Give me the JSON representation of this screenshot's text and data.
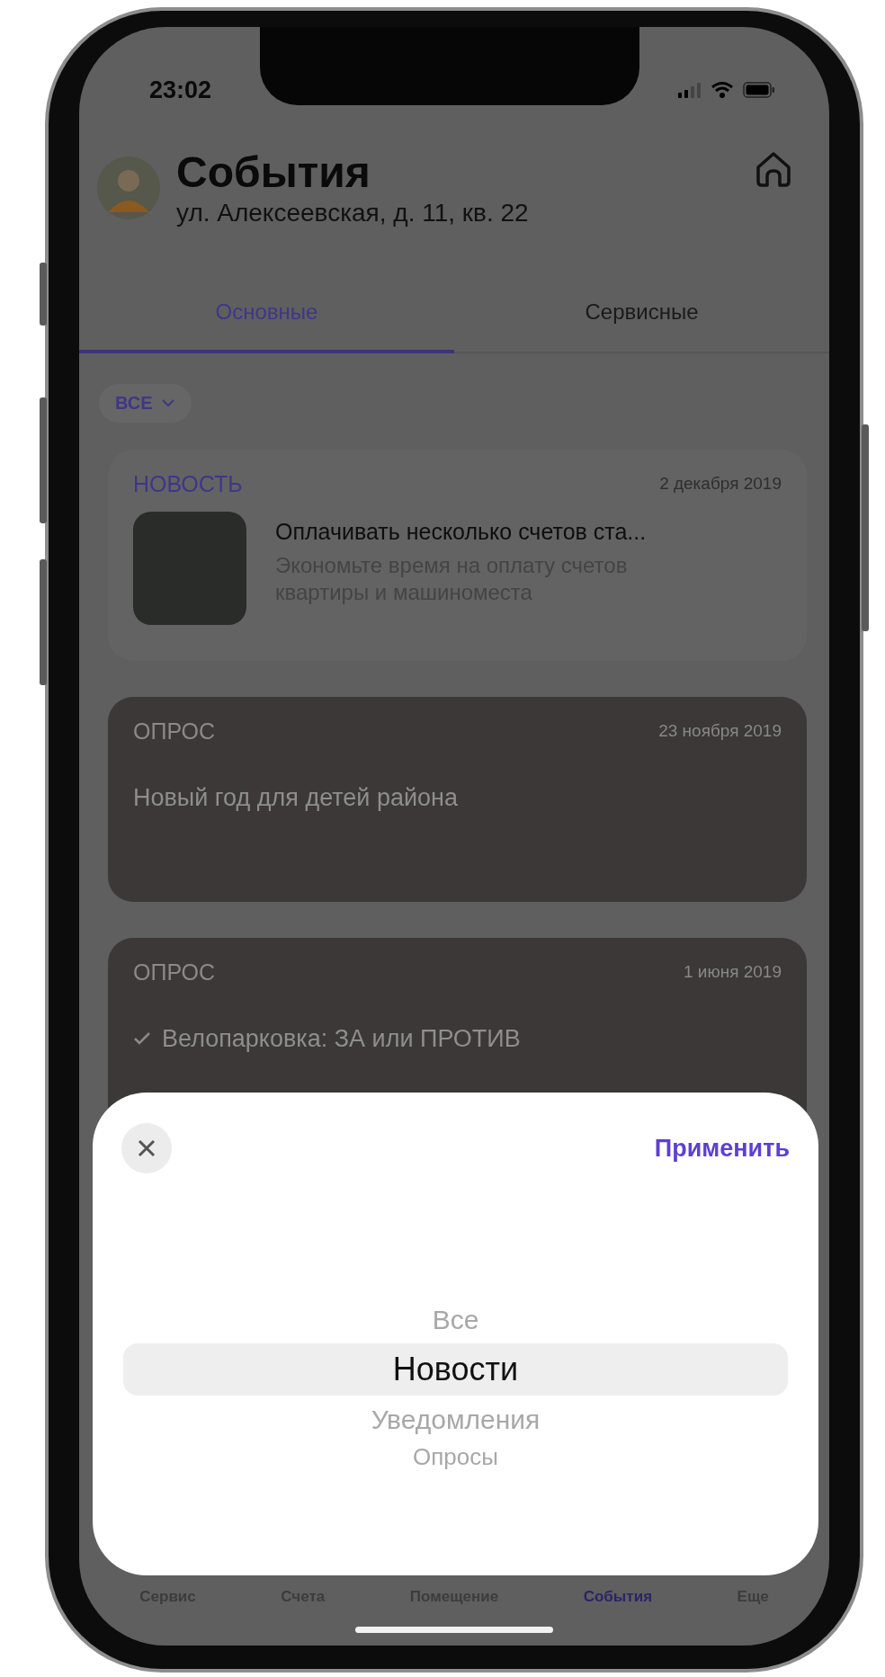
{
  "status_bar": {
    "time": "23:02"
  },
  "header": {
    "title": "События",
    "address": "ул. Алексеевская, д. 11, кв. 22"
  },
  "tabs": [
    {
      "label": "Основные",
      "selected": true
    },
    {
      "label": "Сервисные",
      "selected": false
    }
  ],
  "filter_chip": {
    "label": "ВСЕ"
  },
  "events": [
    {
      "kind": "news",
      "category": "НОВОСТЬ",
      "date": "2 декабря 2019",
      "title": "Оплачивать несколько счетов ста...",
      "description": "Экономьте время на оплату счетов квартиры и машиноместа"
    },
    {
      "kind": "poll",
      "category": "ОПРОС",
      "date": "23 ноября 2019",
      "title": "Новый год для детей района",
      "voted": false
    },
    {
      "kind": "poll",
      "category": "ОПРОС",
      "date": "1 июня 2019",
      "title": "Велопарковка: ЗА или ПРОТИВ",
      "voted": true
    }
  ],
  "bottom_nav": [
    {
      "label": "Сервис",
      "selected": false
    },
    {
      "label": "Счета",
      "selected": false
    },
    {
      "label": "Помещение",
      "selected": false
    },
    {
      "label": "События",
      "selected": true
    },
    {
      "label": "Еще",
      "selected": false
    }
  ],
  "filter_sheet": {
    "apply_label": "Применить",
    "options": [
      {
        "label": "Все",
        "selected": false
      },
      {
        "label": "Новости",
        "selected": true
      },
      {
        "label": "Уведомления",
        "selected": false
      },
      {
        "label": "Опросы",
        "selected": false
      }
    ]
  }
}
